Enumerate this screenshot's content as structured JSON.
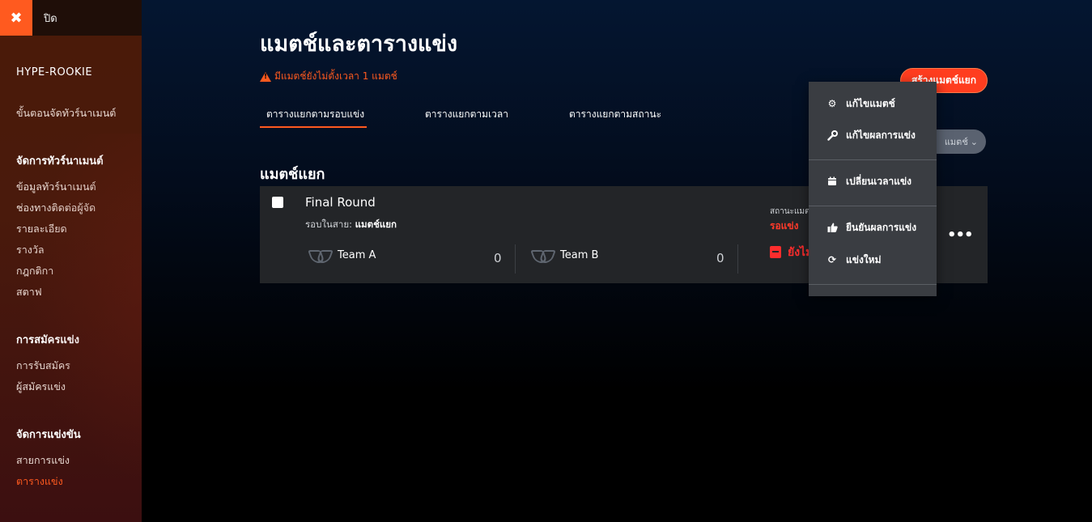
{
  "sidebar": {
    "close_label": "ปิด",
    "tournament_name": "HYPE-ROOKIE",
    "steps_link": "ขั้นตอนจัดทัวร์นาเมนต์",
    "sections": [
      {
        "heading": "จัดการทัวร์นาเมนต์",
        "items": [
          "ข้อมูลทัวร์นาเมนต์",
          "ช่องทางติดต่อผู้จัด",
          "รายละเอียด",
          "รางวัล",
          "กฎกติกา",
          "สตาฟ"
        ]
      },
      {
        "heading": "การสมัครแข่ง",
        "items": [
          "การรับสมัคร",
          "ผู้สมัครแข่ง"
        ]
      },
      {
        "heading": "จัดการแข่งขัน",
        "items": [
          "สายการแข่ง",
          "ตารางแข่ง"
        ]
      }
    ],
    "active_item": "ตารางแข่ง"
  },
  "main": {
    "title": "แมตช์และตารางแข่ง",
    "warning": "มีแมตช์ยังไม่ตั้งเวลา 1 แมตช์",
    "create_button": "สร้างแมตช์แยก",
    "tabs": [
      "ตารางแยกตามรอบแข่ง",
      "ตารางแยกตามเวลา",
      "ตารางแยกตามสถานะ"
    ],
    "active_tab": 0,
    "filter_label": "แมตช์",
    "section_title": "แมตช์แยก"
  },
  "match": {
    "name": "Final Round",
    "round_label": "รอบในสาย:",
    "round_value": "แมตช์แยก",
    "team_a": "Team A",
    "score_a": "0",
    "team_b": "Team B",
    "score_b": "0",
    "status_label": "สถานะแมตช์",
    "status_value": "รอแข่ง",
    "schedule_text": "ยังไม่"
  },
  "menu": {
    "items": [
      {
        "label": "แก้ไขแมตช์",
        "icon": "gear-icon"
      },
      {
        "label": "แก้ไขผลการแข่ง",
        "icon": "wrench-icon"
      },
      {
        "label": "เปลี่ยนเวลาแข่ง",
        "icon": "calendar-icon"
      },
      {
        "label": "ยืนยันผลการแข่ง",
        "icon": "thumbs-up-icon"
      },
      {
        "label": "แข่งใหม่",
        "icon": "refresh-icon"
      }
    ]
  },
  "colors": {
    "accent": "#ff5a1f",
    "danger": "#ff2d2d",
    "card": "#232528",
    "menu": "#3a3d42"
  }
}
